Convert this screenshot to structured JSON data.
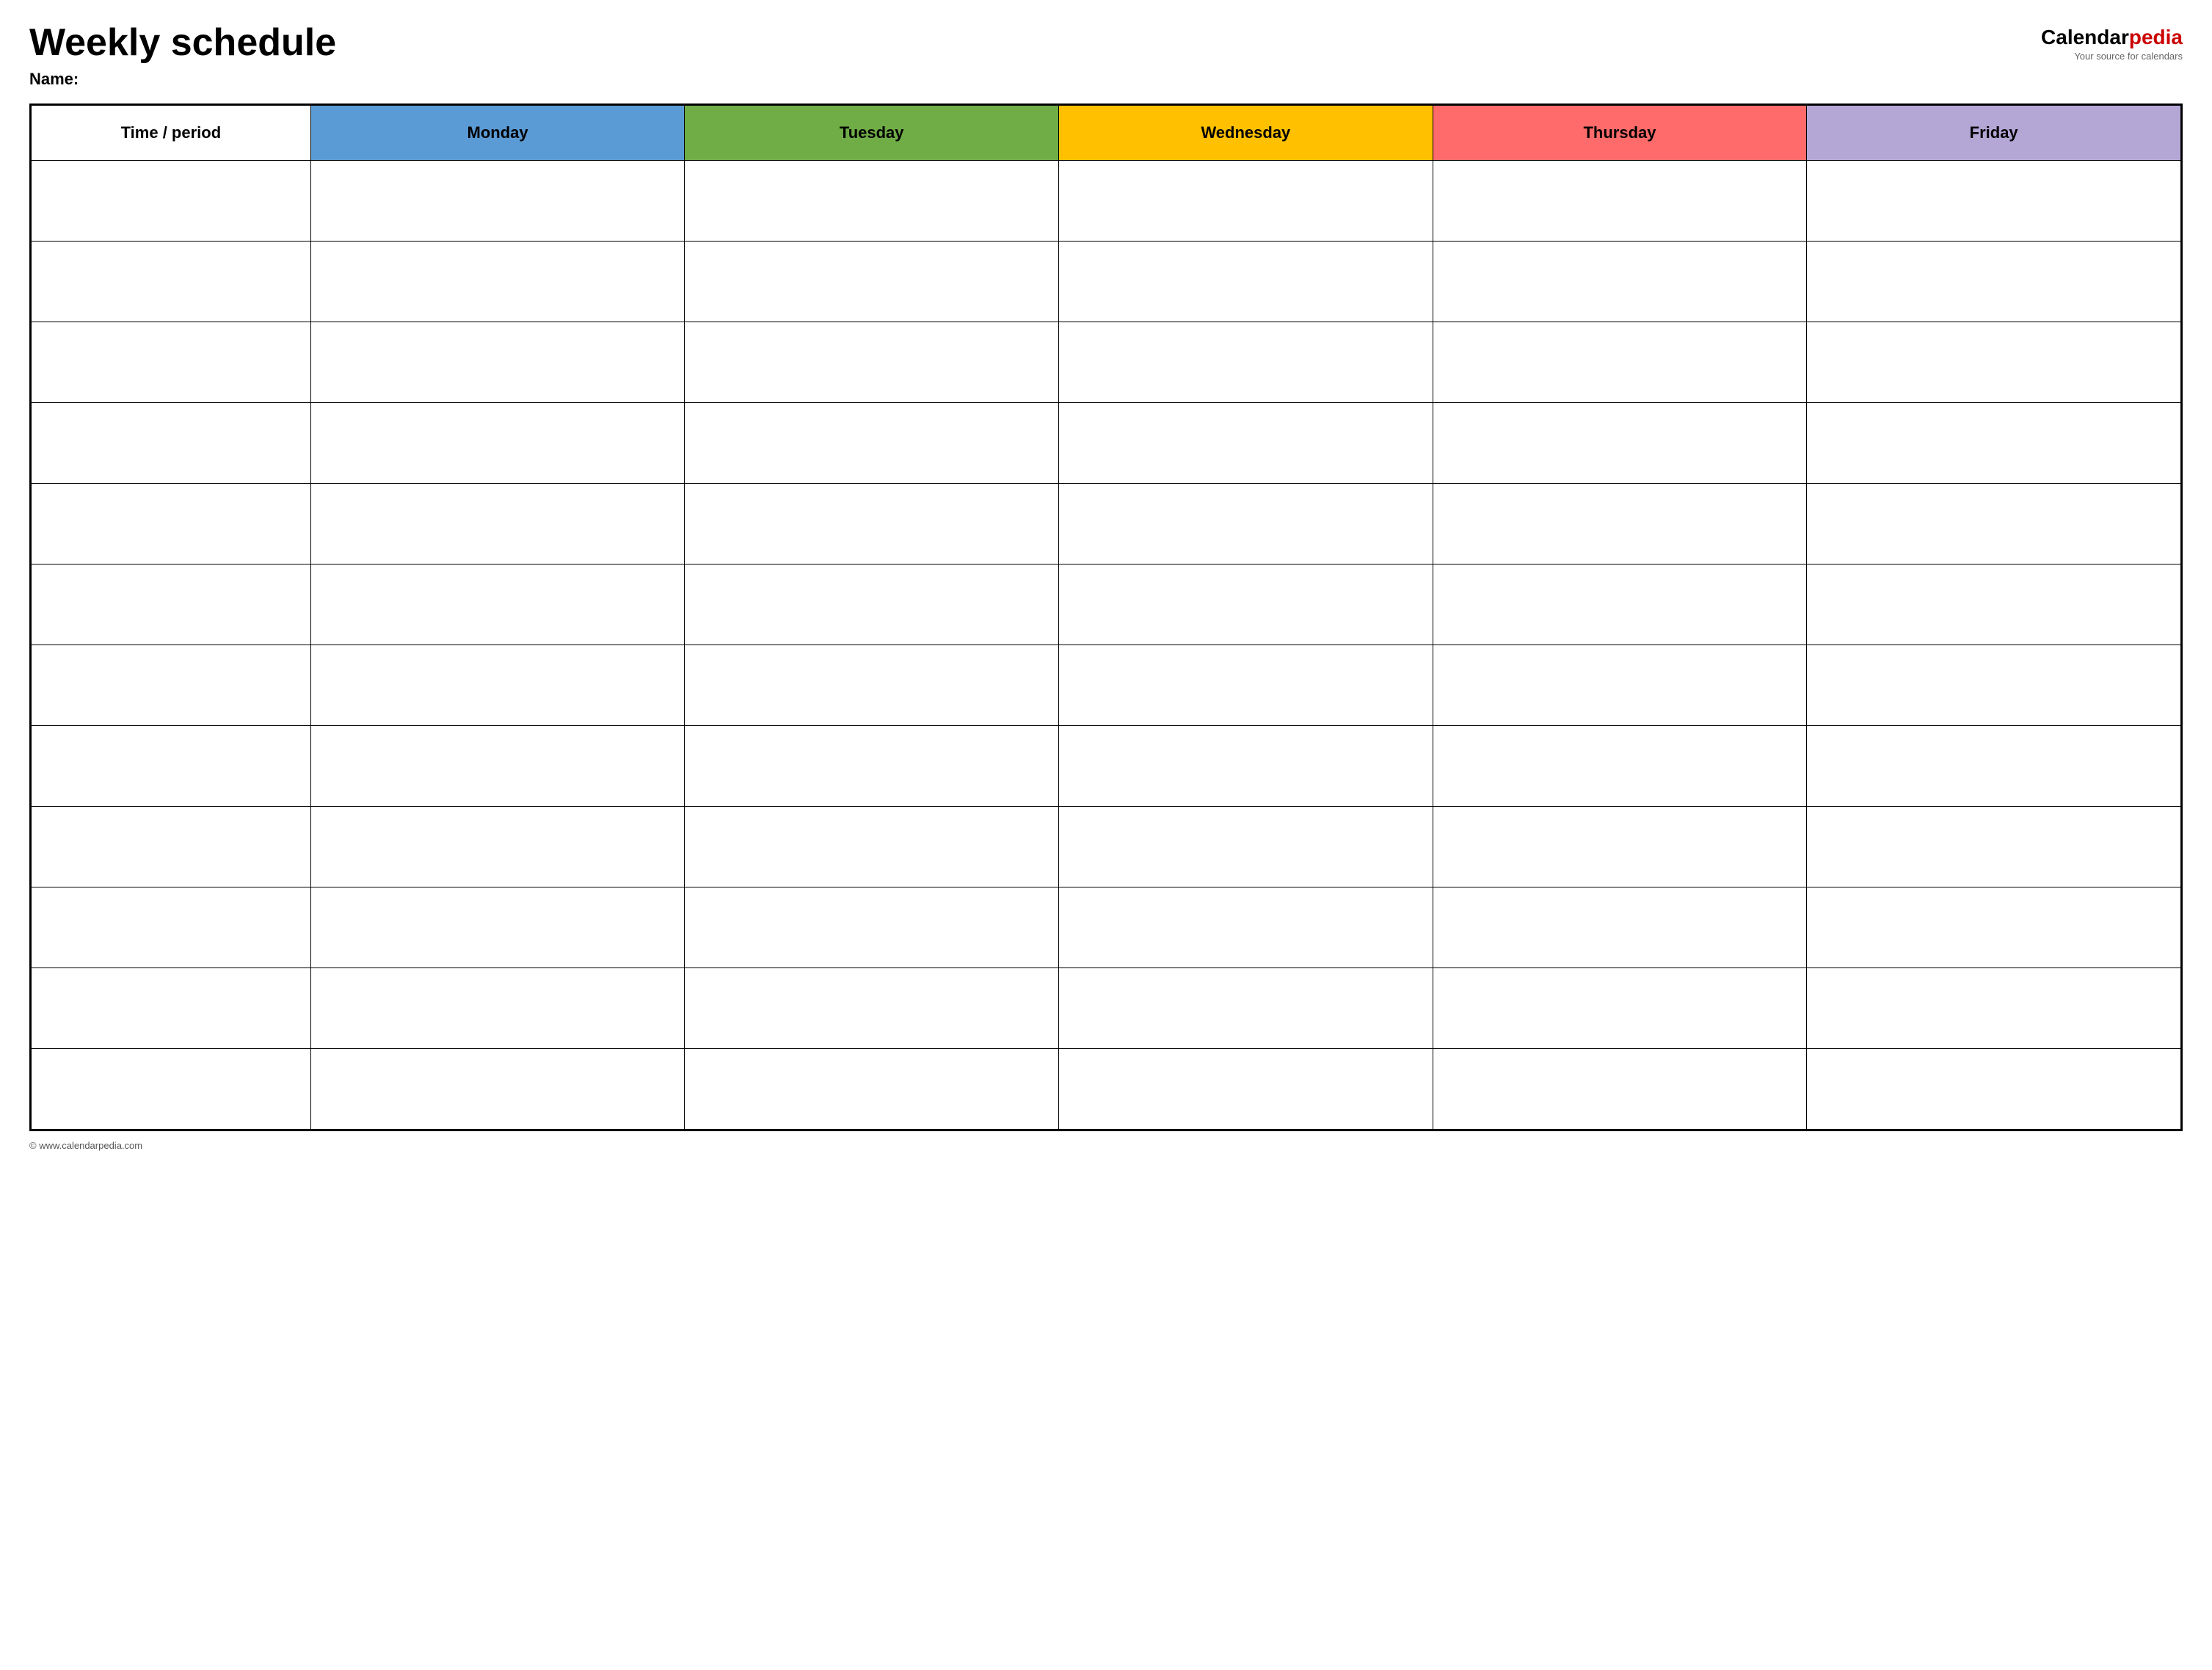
{
  "header": {
    "title": "Weekly schedule",
    "name_label": "Name:",
    "logo": {
      "calendar_part": "Calendar",
      "pedia_part": "pedia",
      "tagline": "Your source for calendars"
    }
  },
  "table": {
    "columns": [
      {
        "id": "time",
        "label": "Time / period",
        "color": "#ffffff"
      },
      {
        "id": "monday",
        "label": "Monday",
        "color": "#5b9bd5"
      },
      {
        "id": "tuesday",
        "label": "Tuesday",
        "color": "#70ad47"
      },
      {
        "id": "wednesday",
        "label": "Wednesday",
        "color": "#ffc000"
      },
      {
        "id": "thursday",
        "label": "Thursday",
        "color": "#ff6b6b"
      },
      {
        "id": "friday",
        "label": "Friday",
        "color": "#b4a7d6"
      }
    ],
    "row_count": 12
  },
  "footer": {
    "url": "© www.calendarpedia.com"
  }
}
